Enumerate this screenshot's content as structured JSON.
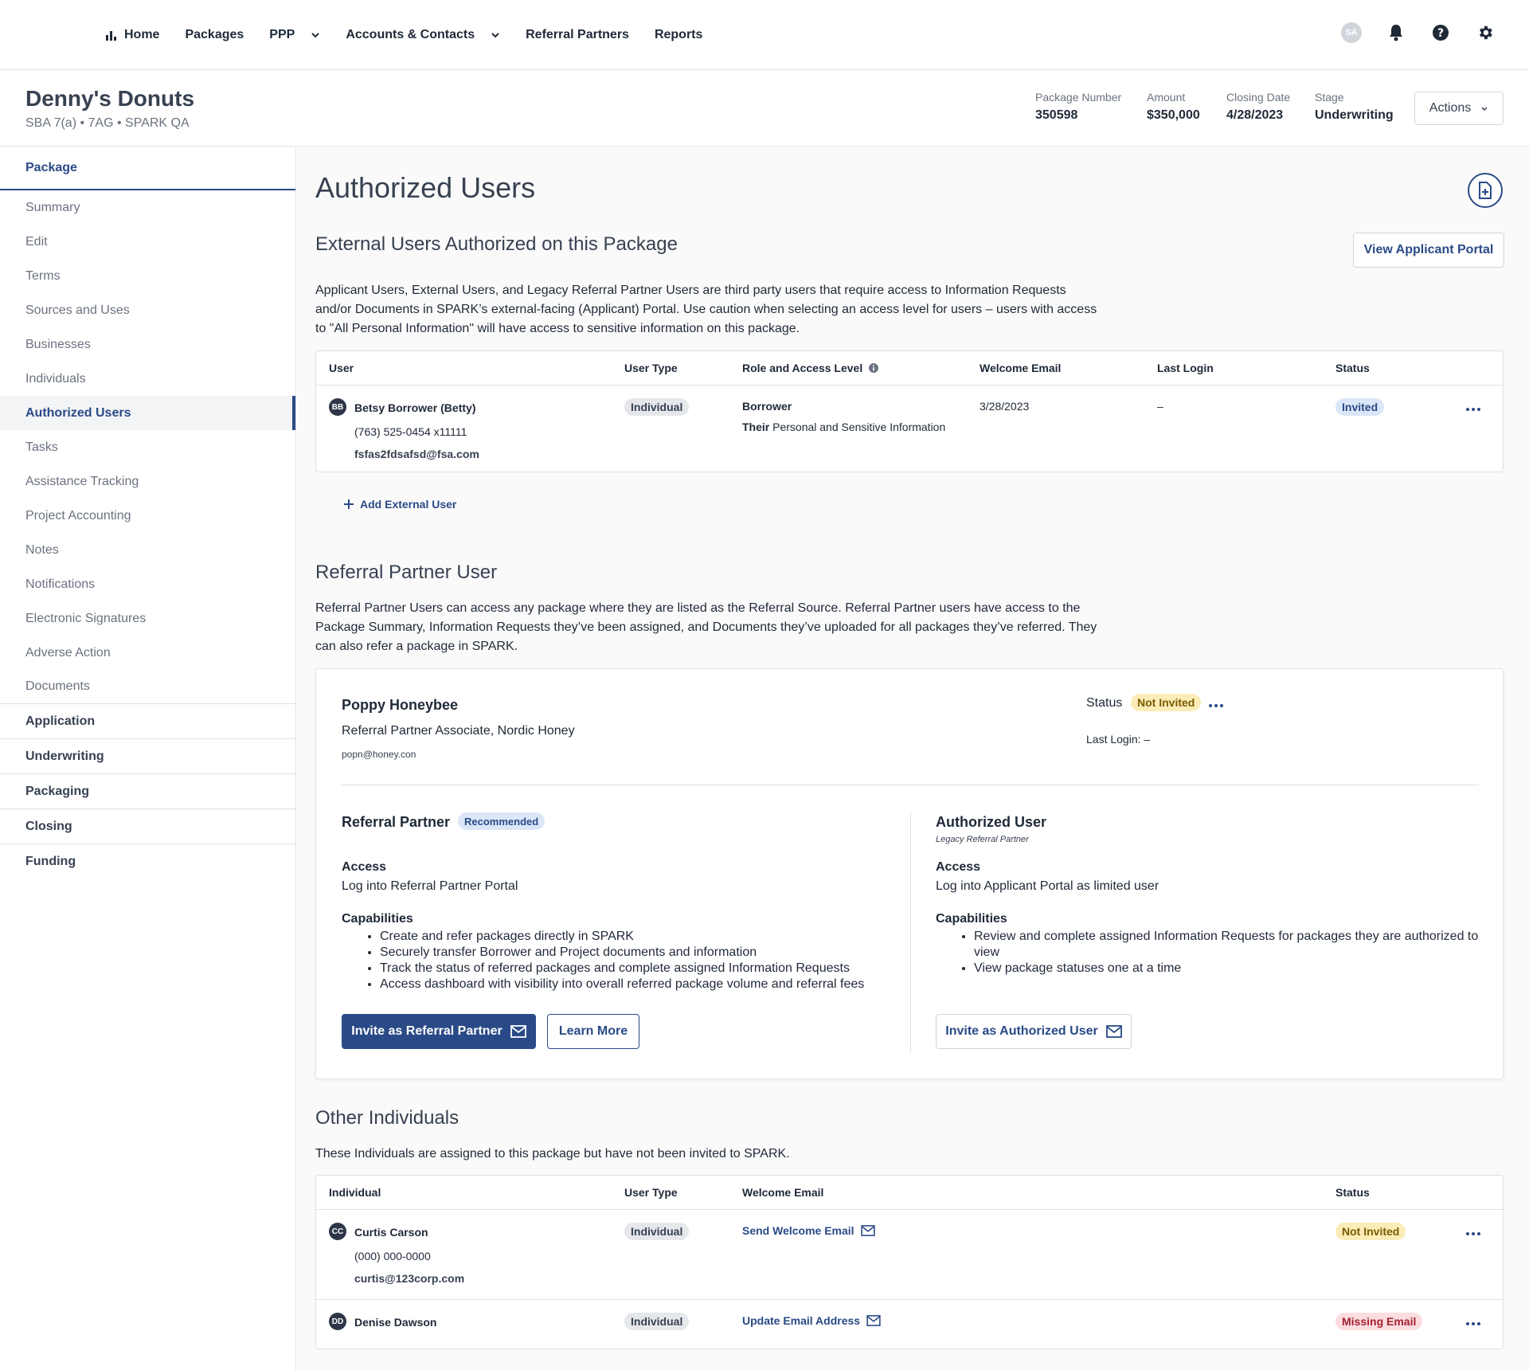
{
  "nav": {
    "items": [
      {
        "label": "Home"
      },
      {
        "label": "Packages"
      },
      {
        "label": "PPP"
      },
      {
        "label": "Accounts & Contacts"
      },
      {
        "label": "Referral Partners"
      },
      {
        "label": "Reports"
      }
    ],
    "avatar": "SA"
  },
  "package": {
    "name": "Denny's Donuts",
    "subtitle": "SBA 7(a) • 7AG • SPARK QA",
    "meta": [
      {
        "label": "Package Number",
        "value": "350598"
      },
      {
        "label": "Amount",
        "value": "$350,000"
      },
      {
        "label": "Closing Date",
        "value": "4/28/2023"
      },
      {
        "label": "Stage",
        "value": "Underwriting"
      }
    ],
    "actions_label": "Actions"
  },
  "sidebar": {
    "package_label": "Package",
    "items": [
      "Summary",
      "Edit",
      "Terms",
      "Sources and Uses",
      "Businesses",
      "Individuals",
      "Authorized Users",
      "Tasks",
      "Assistance Tracking",
      "Project Accounting",
      "Notes",
      "Notifications",
      "Electronic Signatures",
      "Adverse Action",
      "Documents"
    ],
    "active_item": "Authorized Users",
    "sections": [
      "Application",
      "Underwriting",
      "Packaging",
      "Closing",
      "Funding"
    ]
  },
  "main": {
    "title": "Authorized Users",
    "external": {
      "heading": "External Users Authorized on this Package",
      "view_portal": "View Applicant Portal",
      "description": "Applicant Users, External Users, and Legacy Referral Partner Users are third party users that require access to Information Requests and/or Documents in SPARK’s external-facing (Applicant) Portal. Use caution when selecting an access level for users – users with access to \"All Personal Information\" will have access to sensitive information on this package.",
      "columns": [
        "User",
        "User Type",
        "Role and Access Level",
        "Welcome Email",
        "Last Login",
        "Status"
      ],
      "rows": [
        {
          "initials": "BB",
          "name": "Betsy Borrower (Betty)",
          "phone": "(763) 525-0454 x11111",
          "email": "fsfas2fdsafsd@fsa.com",
          "user_type": "Individual",
          "role": "Borrower",
          "access_prefix": "Their",
          "access": "Personal and Sensitive Information",
          "welcome_email": "3/28/2023",
          "last_login": "–",
          "status": "Invited"
        }
      ],
      "add_label": "Add External User"
    },
    "referral": {
      "heading": "Referral Partner User",
      "description": "Referral Partner Users can access any package where they are listed as the Referral Source. Referral Partner users have access to the Package Summary, Information Requests they’ve been assigned, and Documents they’ve uploaded for all packages they’ve referred. They can also refer a package in SPARK.",
      "name": "Poppy Honeybee",
      "role": "Referral Partner Associate, Nordic Honey",
      "email": "popn@honey.con",
      "status_label": "Status",
      "status": "Not Invited",
      "last_login_label": "Last Login:",
      "last_login": "–",
      "partner": {
        "title": "Referral Partner",
        "badge": "Recommended",
        "access_label": "Access",
        "access": "Log into Referral Partner Portal",
        "capabilities_label": "Capabilities",
        "capabilities": [
          "Create and refer packages directly in SPARK",
          "Securely transfer Borrower and Project documents and information",
          "Track the status of referred packages and complete assigned Information Requests",
          "Access dashboard with visibility into overall referred package volume and referral fees"
        ],
        "invite_label": "Invite as Referral Partner",
        "learn_more": "Learn More"
      },
      "authorized": {
        "title": "Authorized User",
        "subtitle": "Legacy Referral Partner",
        "access_label": "Access",
        "access": "Log into Applicant Portal as limited user",
        "capabilities_label": "Capabilities",
        "capabilities": [
          "Review and complete assigned Information Requests for packages they are authorized to view",
          "View package statuses one at a time"
        ],
        "invite_label": "Invite as Authorized User"
      }
    },
    "others": {
      "heading": "Other Individuals",
      "description": "These Individuals are assigned to this package but have not been invited to SPARK.",
      "columns": [
        "Individual",
        "User Type",
        "Welcome Email",
        "Status"
      ],
      "rows": [
        {
          "initials": "CC",
          "name": "Curtis Carson",
          "phone": "(000) 000-0000",
          "email": "curtis@123corp.com",
          "user_type": "Individual",
          "action": "Send Welcome Email",
          "status": "Not Invited"
        },
        {
          "initials": "DD",
          "name": "Denise Dawson",
          "user_type": "Individual",
          "action": "Update Email Address",
          "status": "Missing Email"
        }
      ]
    }
  },
  "colors": {
    "accent": "#2a4a87",
    "invited_bg": "#dbe7f8",
    "not_invited_bg": "#fbecb8",
    "missing_bg": "#fbdde0"
  }
}
